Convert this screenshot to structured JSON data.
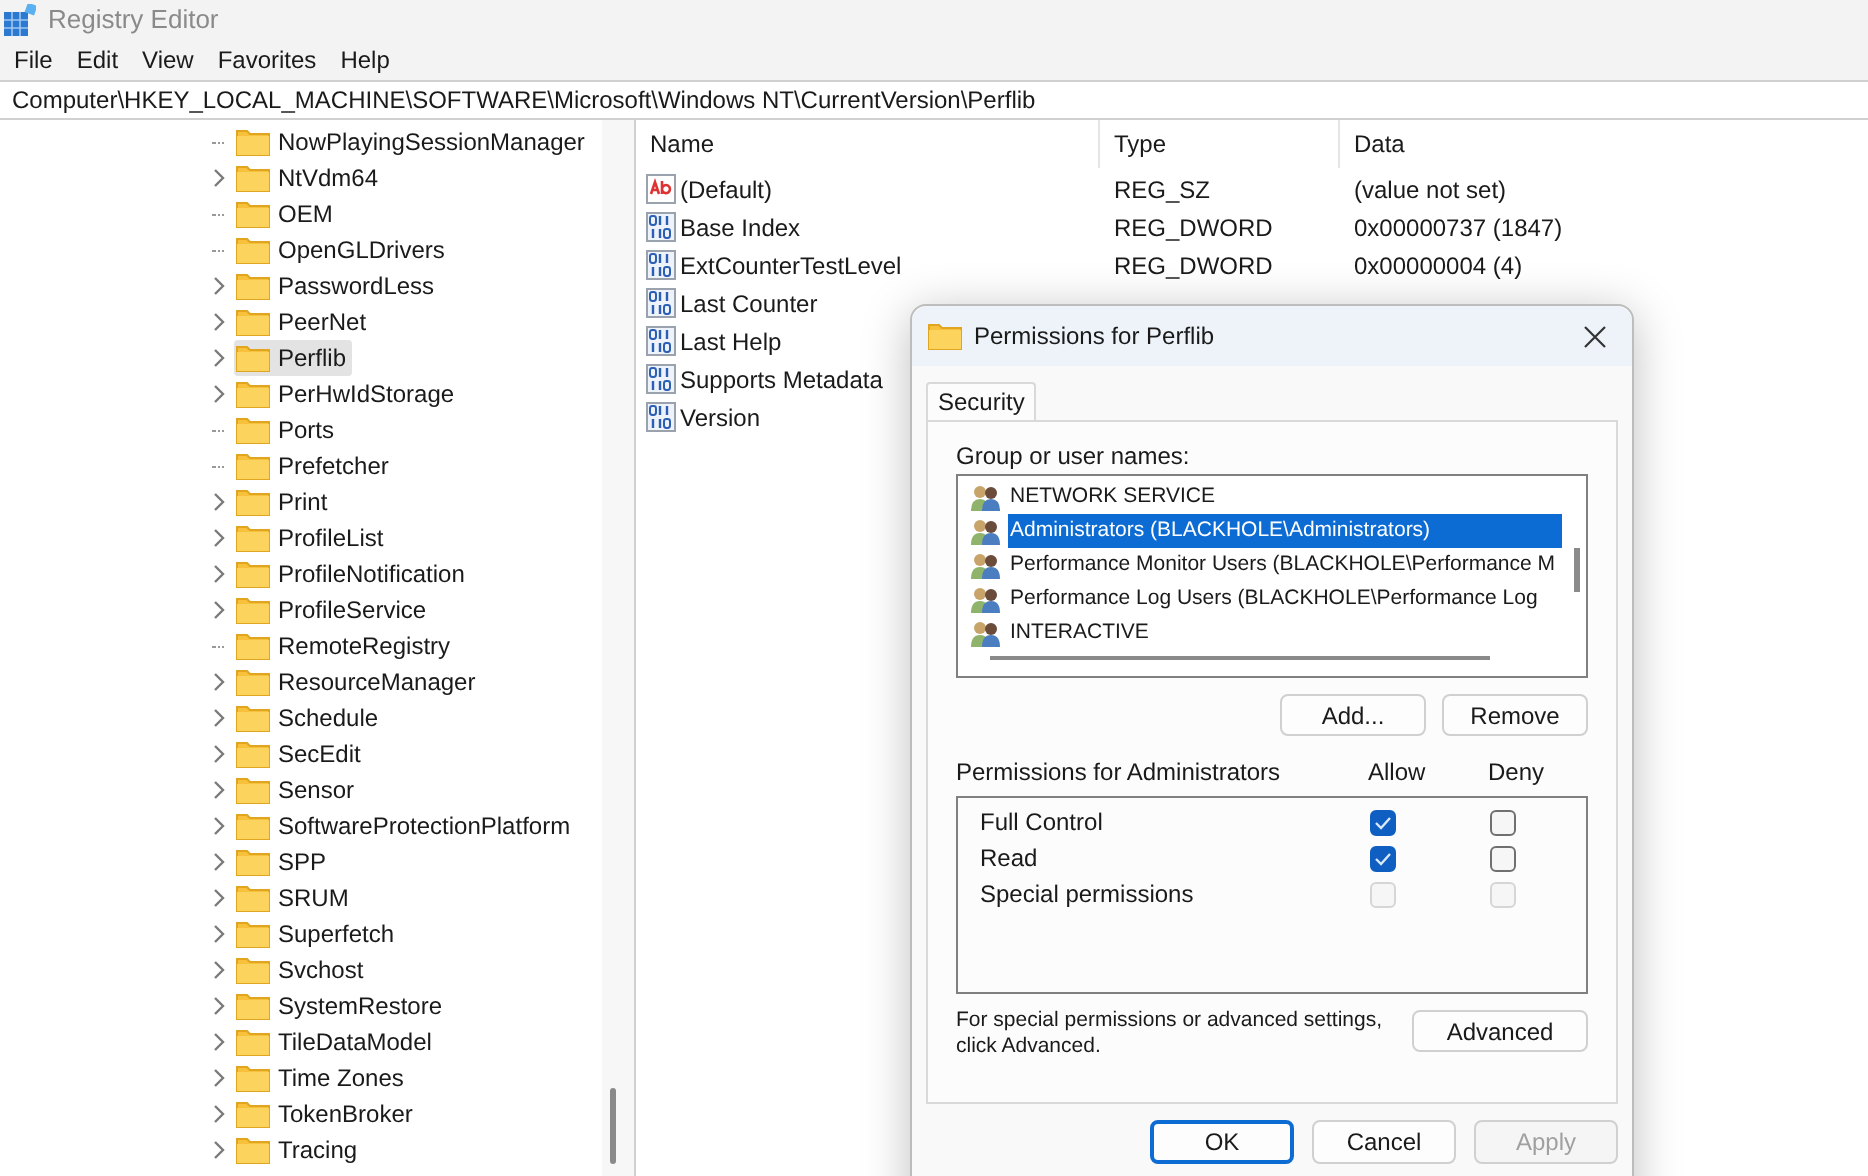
{
  "window": {
    "title": "Registry Editor"
  },
  "menu": [
    "File",
    "Edit",
    "View",
    "Favorites",
    "Help"
  ],
  "address": "Computer\\HKEY_LOCAL_MACHINE\\SOFTWARE\\Microsoft\\Windows NT\\CurrentVersion\\Perflib",
  "tree": {
    "items": [
      {
        "label": "NowPlayingSessionManager",
        "has_children": false,
        "selected": false
      },
      {
        "label": "NtVdm64",
        "has_children": true,
        "selected": false
      },
      {
        "label": "OEM",
        "has_children": false,
        "selected": false
      },
      {
        "label": "OpenGLDrivers",
        "has_children": false,
        "selected": false
      },
      {
        "label": "PasswordLess",
        "has_children": true,
        "selected": false
      },
      {
        "label": "PeerNet",
        "has_children": true,
        "selected": false
      },
      {
        "label": "Perflib",
        "has_children": true,
        "selected": true
      },
      {
        "label": "PerHwIdStorage",
        "has_children": true,
        "selected": false
      },
      {
        "label": "Ports",
        "has_children": false,
        "selected": false
      },
      {
        "label": "Prefetcher",
        "has_children": false,
        "selected": false
      },
      {
        "label": "Print",
        "has_children": true,
        "selected": false
      },
      {
        "label": "ProfileList",
        "has_children": true,
        "selected": false
      },
      {
        "label": "ProfileNotification",
        "has_children": true,
        "selected": false
      },
      {
        "label": "ProfileService",
        "has_children": true,
        "selected": false
      },
      {
        "label": "RemoteRegistry",
        "has_children": false,
        "selected": false
      },
      {
        "label": "ResourceManager",
        "has_children": true,
        "selected": false
      },
      {
        "label": "Schedule",
        "has_children": true,
        "selected": false
      },
      {
        "label": "SecEdit",
        "has_children": true,
        "selected": false
      },
      {
        "label": "Sensor",
        "has_children": true,
        "selected": false
      },
      {
        "label": "SoftwareProtectionPlatform",
        "has_children": true,
        "selected": false
      },
      {
        "label": "SPP",
        "has_children": true,
        "selected": false
      },
      {
        "label": "SRUM",
        "has_children": true,
        "selected": false
      },
      {
        "label": "Superfetch",
        "has_children": true,
        "selected": false
      },
      {
        "label": "Svchost",
        "has_children": true,
        "selected": false
      },
      {
        "label": "SystemRestore",
        "has_children": true,
        "selected": false
      },
      {
        "label": "TileDataModel",
        "has_children": true,
        "selected": false
      },
      {
        "label": "Time Zones",
        "has_children": true,
        "selected": false
      },
      {
        "label": "TokenBroker",
        "has_children": true,
        "selected": false
      },
      {
        "label": "Tracing",
        "has_children": true,
        "selected": false
      }
    ]
  },
  "values": {
    "columns": [
      "Name",
      "Type",
      "Data"
    ],
    "rows": [
      {
        "kind": "string",
        "name": "(Default)",
        "type": "REG_SZ",
        "data": "(value not set)"
      },
      {
        "kind": "dword",
        "name": "Base Index",
        "type": "REG_DWORD",
        "data": "0x00000737 (1847)"
      },
      {
        "kind": "dword",
        "name": "ExtCounterTestLevel",
        "type": "REG_DWORD",
        "data": "0x00000004 (4)"
      },
      {
        "kind": "dword",
        "name": "Last Counter"
      },
      {
        "kind": "dword",
        "name": "Last Help"
      },
      {
        "kind": "dword",
        "name": "Supports Metadata"
      },
      {
        "kind": "dword",
        "name": "Version"
      }
    ]
  },
  "dialog": {
    "title": "Permissions for Perflib",
    "tabs": [
      {
        "label": "Security",
        "selected": true
      }
    ],
    "group_label": "Group or user names:",
    "users": [
      {
        "name": "NETWORK SERVICE",
        "selected": false
      },
      {
        "name": "Administrators (BLACKHOLE\\Administrators)",
        "selected": true
      },
      {
        "name": "Performance Monitor Users (BLACKHOLE\\Performance M",
        "selected": false
      },
      {
        "name": "Performance Log Users (BLACKHOLE\\Performance Log",
        "selected": false
      },
      {
        "name": "INTERACTIVE",
        "selected": false
      }
    ],
    "user_buttons": [
      "Add...",
      "Remove"
    ],
    "permissions_label": "Permissions for Administrators",
    "allow_label": "Allow",
    "deny_label": "Deny",
    "permissions": [
      {
        "name": "Full Control",
        "allow": {
          "checked": true,
          "disabled": false
        },
        "deny": {
          "checked": false,
          "disabled": false
        }
      },
      {
        "name": "Read",
        "allow": {
          "checked": true,
          "disabled": false
        },
        "deny": {
          "checked": false,
          "disabled": false
        }
      },
      {
        "name": "Special permissions",
        "allow": {
          "checked": false,
          "disabled": true
        },
        "deny": {
          "checked": false,
          "disabled": true
        }
      }
    ],
    "advanced_note": "For special permissions or advanced settings, click Advanced.",
    "advanced_button": "Advanced",
    "buttons": [
      {
        "label": "OK",
        "disabled": false,
        "default": true
      },
      {
        "label": "Cancel",
        "disabled": false,
        "default": false
      },
      {
        "label": "Apply",
        "disabled": true,
        "default": false
      }
    ]
  }
}
